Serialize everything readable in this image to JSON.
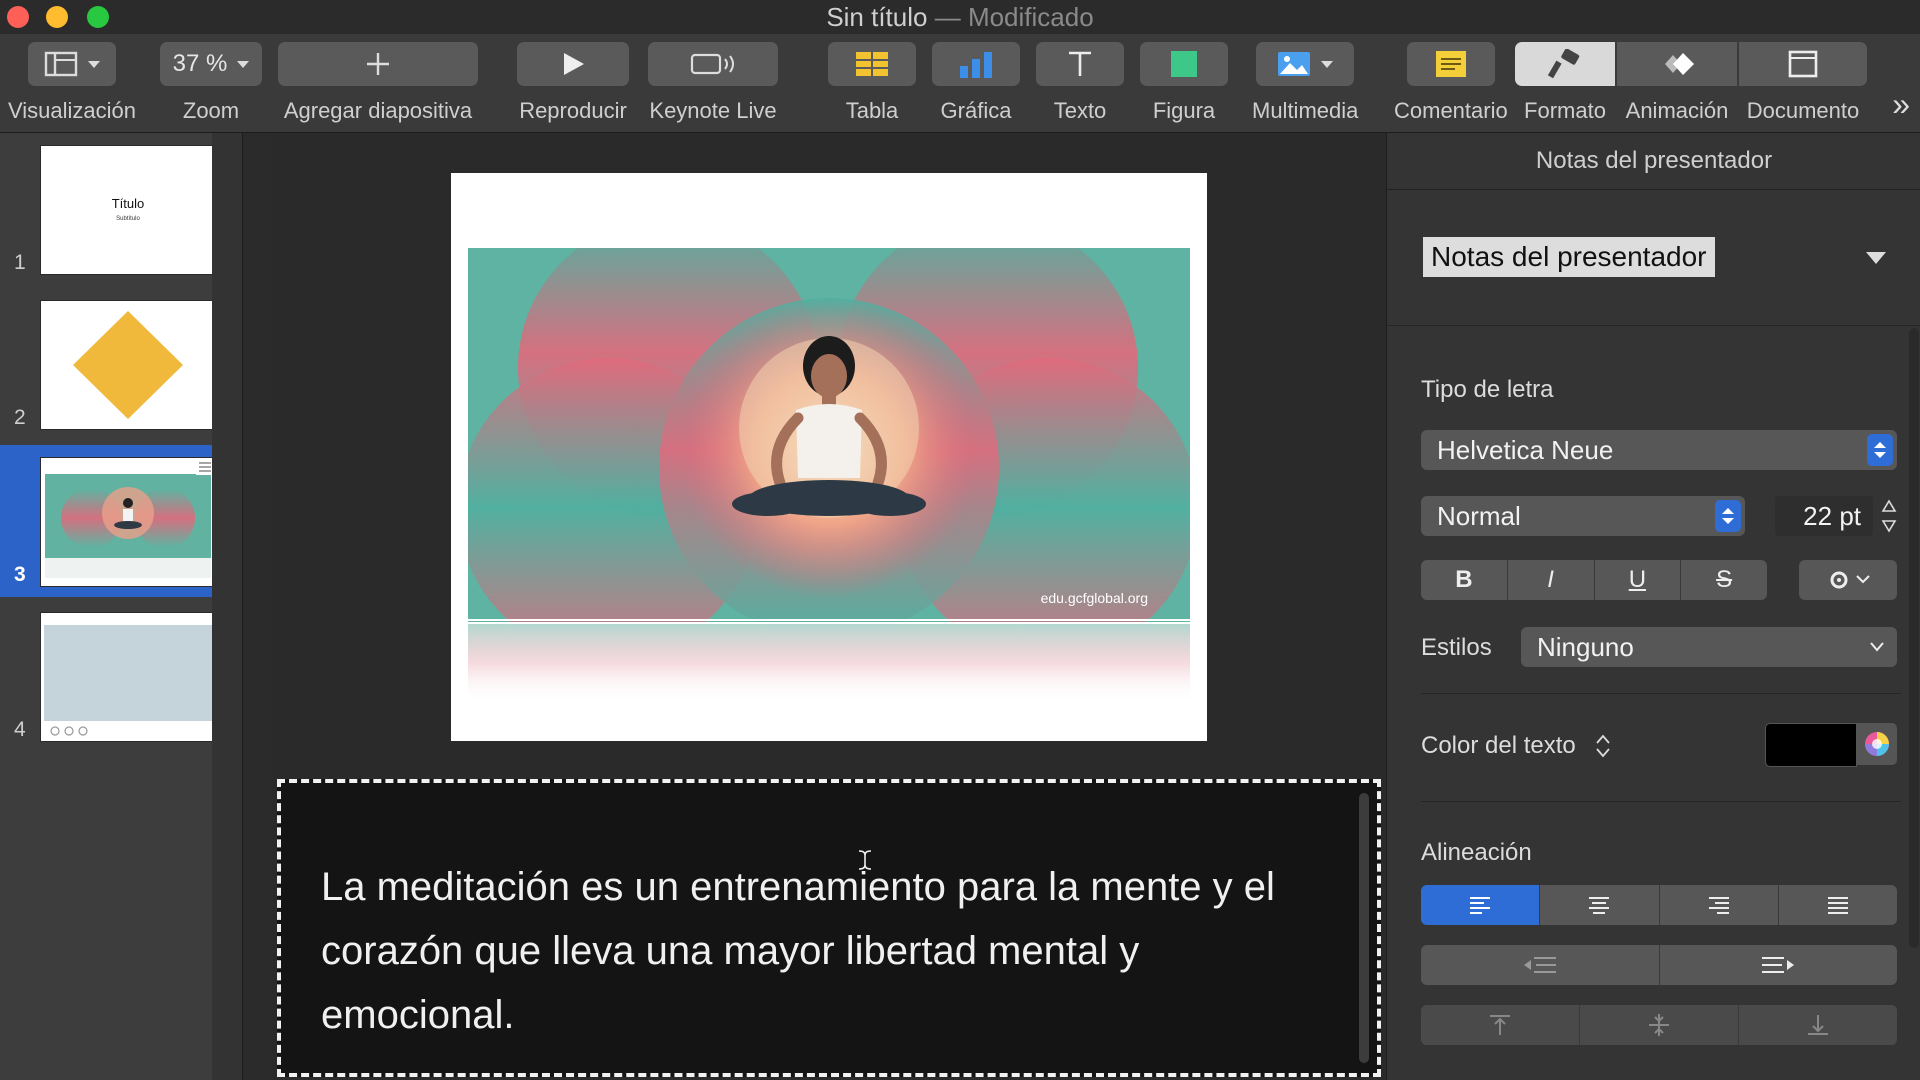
{
  "window": {
    "title": "Sin título",
    "separator": " — ",
    "status": "Modificado"
  },
  "toolbar": {
    "view_label": "Visualización",
    "zoom_value": "37 %",
    "zoom_label": "Zoom",
    "add_slide_label": "Agregar diapositiva",
    "play_label": "Reproducir",
    "keynote_live_label": "Keynote Live",
    "table_label": "Tabla",
    "chart_label": "Gráfica",
    "text_label": "Texto",
    "shape_label": "Figura",
    "media_label": "Multimedia",
    "comment_label": "Comentario",
    "format_label": "Formato",
    "animate_label": "Animación",
    "document_label": "Documento",
    "more_glyph": "»"
  },
  "navigator": {
    "slides": [
      {
        "number": "1",
        "title": "Título",
        "subtitle": "Subtítulo"
      },
      {
        "number": "2"
      },
      {
        "number": "3"
      },
      {
        "number": "4"
      }
    ],
    "selected_index": 3
  },
  "slide": {
    "credit": "edu.gcfglobal.org"
  },
  "notes": {
    "text": "La meditación es un entrenamiento para la mente y el corazón que lleva una mayor libertad mental y emocional."
  },
  "inspector": {
    "title": "Notas del presentador",
    "style_popup": "Notas del presentador",
    "font_section": "Tipo de letra",
    "font_family": "Helvetica Neue",
    "font_style": "Normal",
    "font_size": "22 pt",
    "bold": "B",
    "italic": "I",
    "underline": "U",
    "strike": "S",
    "styles_label": "Estilos",
    "styles_value": "Ninguno",
    "text_color_label": "Color del texto",
    "text_color": "#000000",
    "alignment_section": "Alineación",
    "alignment_selected": "left"
  },
  "colors": {
    "accent": "#2f6dd6",
    "selection": "#2b63c9",
    "slide2_diamond": "#f0b93b",
    "slide4_block": "#c5d3db"
  }
}
